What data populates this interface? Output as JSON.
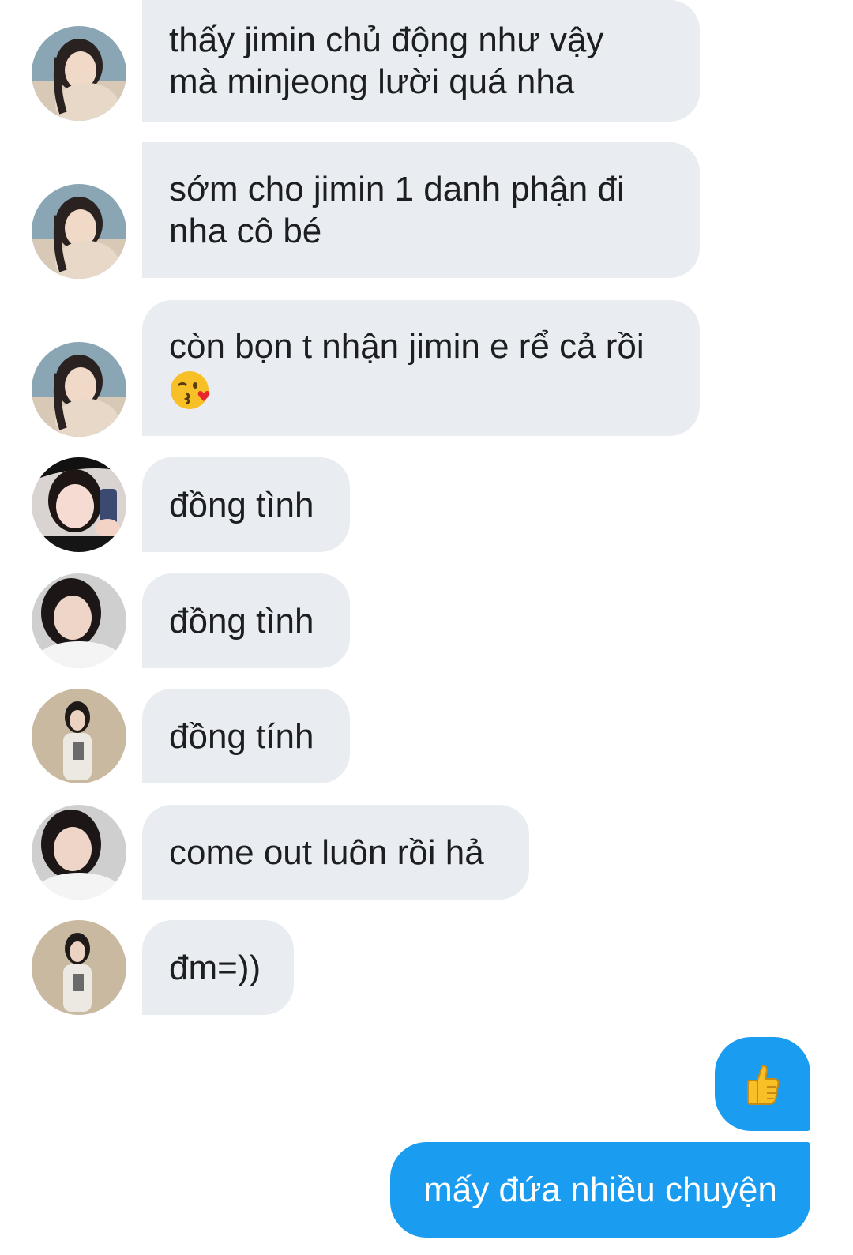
{
  "messages": [
    {
      "lines": [
        "thấy jimin chủ động như vậy",
        "mà minjeong lười quá nha"
      ],
      "avatar": "avatar-a"
    },
    {
      "lines": [
        "sớm cho jimin 1 danh phận đi",
        "nha cô bé"
      ],
      "avatar": "avatar-a"
    },
    {
      "lines": [
        "còn bọn t nhận jimin e rể cả rồi"
      ],
      "emoji": "kissing-wink-heart-emoji",
      "avatar": "avatar-a"
    },
    {
      "lines": [
        "đồng tình"
      ],
      "avatar": "avatar-b"
    },
    {
      "lines": [
        "đồng tình"
      ],
      "avatar": "avatar-c"
    },
    {
      "lines": [
        "đồng tính"
      ],
      "avatar": "avatar-d"
    },
    {
      "lines": [
        "come out luôn rồi hả"
      ],
      "avatar": "avatar-c"
    },
    {
      "lines": [
        "đm=))"
      ],
      "avatar": "avatar-d"
    }
  ],
  "outgoing": {
    "thumbs_up": "👍",
    "text": "mấy đứa nhiều chuyện"
  },
  "colors": {
    "incoming_bubble": "#e9ecf0",
    "outgoing_bubble": "#1a9cf0",
    "incoming_text": "#1c1e21",
    "outgoing_text": "#ffffff"
  }
}
